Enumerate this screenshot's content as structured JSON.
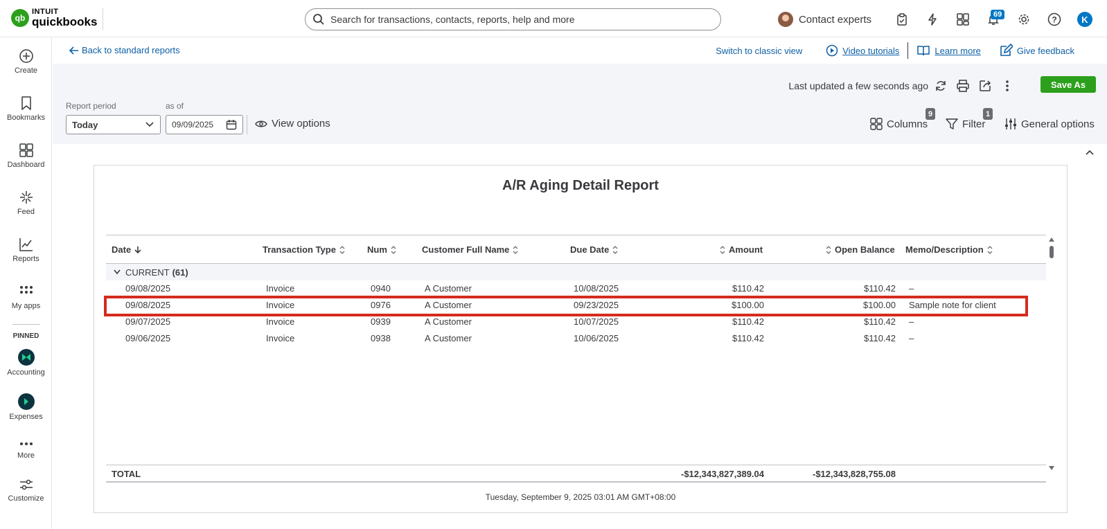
{
  "topbar": {
    "logo_top": "INTUIT",
    "logo_bottom": "quickbooks",
    "logo_mark": "qb",
    "search_placeholder": "Search for transactions, contacts, reports, help and more",
    "contact_experts": "Contact experts",
    "notification_count": "69",
    "user_initial": "K",
    "icons": [
      "search-icon",
      "clipboard-icon",
      "lightning-icon",
      "apps-icon",
      "bell-icon",
      "gear-icon",
      "help-icon"
    ]
  },
  "leftnav": {
    "items": [
      {
        "label": "Create",
        "icon": "plus-circle-icon"
      },
      {
        "label": "Bookmarks",
        "icon": "bookmark-icon"
      },
      {
        "label": "Dashboard",
        "icon": "dashboard-icon"
      },
      {
        "label": "Feed",
        "icon": "sparkle-icon"
      },
      {
        "label": "Reports",
        "icon": "chart-icon"
      },
      {
        "label": "My apps",
        "icon": "grid-icon"
      }
    ],
    "pinned_label": "PINNED",
    "pinned": [
      {
        "label": "Accounting",
        "icon": "accounting-icon"
      },
      {
        "label": "Expenses",
        "icon": "expenses-icon"
      }
    ],
    "more": "More",
    "customize": "Customize"
  },
  "linkbar": {
    "back": "Back to standard reports",
    "switch": "Switch to classic view",
    "video": "Video tutorials",
    "learn": "Learn more",
    "feedback": "Give feedback"
  },
  "controls": {
    "last_updated": "Last updated a few seconds ago",
    "save_as": "Save As",
    "report_period_label": "Report period",
    "report_period_value": "Today",
    "as_of_label": "as of",
    "as_of_value": "09/09/2025",
    "view_options": "View options",
    "columns": "Columns",
    "columns_count": "9",
    "filter": "Filter",
    "filter_count": "1",
    "general_options": "General options"
  },
  "report": {
    "title": "A/R Aging Detail Report",
    "columns": [
      "Date",
      "Transaction Type",
      "Num",
      "Customer Full Name",
      "Due Date",
      "Amount",
      "Open Balance",
      "Memo/Description"
    ],
    "group_name": "CURRENT",
    "group_count": "(61)",
    "rows": [
      {
        "date": "09/08/2025",
        "type": "Invoice",
        "num": "0940",
        "customer": "A Customer",
        "due": "10/08/2025",
        "amount": "$110.42",
        "balance": "$110.42",
        "memo": "–"
      },
      {
        "date": "09/08/2025",
        "type": "Invoice",
        "num": "0976",
        "customer": "A Customer",
        "due": "09/23/2025",
        "amount": "$100.00",
        "balance": "$100.00",
        "memo": "Sample note for client"
      },
      {
        "date": "09/07/2025",
        "type": "Invoice",
        "num": "0939",
        "customer": "A Customer",
        "due": "10/07/2025",
        "amount": "$110.42",
        "balance": "$110.42",
        "memo": "–"
      },
      {
        "date": "09/06/2025",
        "type": "Invoice",
        "num": "0938",
        "customer": "A Customer",
        "due": "10/06/2025",
        "amount": "$110.42",
        "balance": "$110.42",
        "memo": "–"
      }
    ],
    "total_label": "TOTAL",
    "total_amount": "-$12,343,827,389.04",
    "total_balance": "-$12,343,828,755.08",
    "timestamp": "Tuesday, September 9, 2025 03:01 AM GMT+08:00"
  },
  "colors": {
    "brand_green": "#2ca01c",
    "link_blue": "#0d5fa6",
    "highlight_red": "#d52b1e"
  }
}
